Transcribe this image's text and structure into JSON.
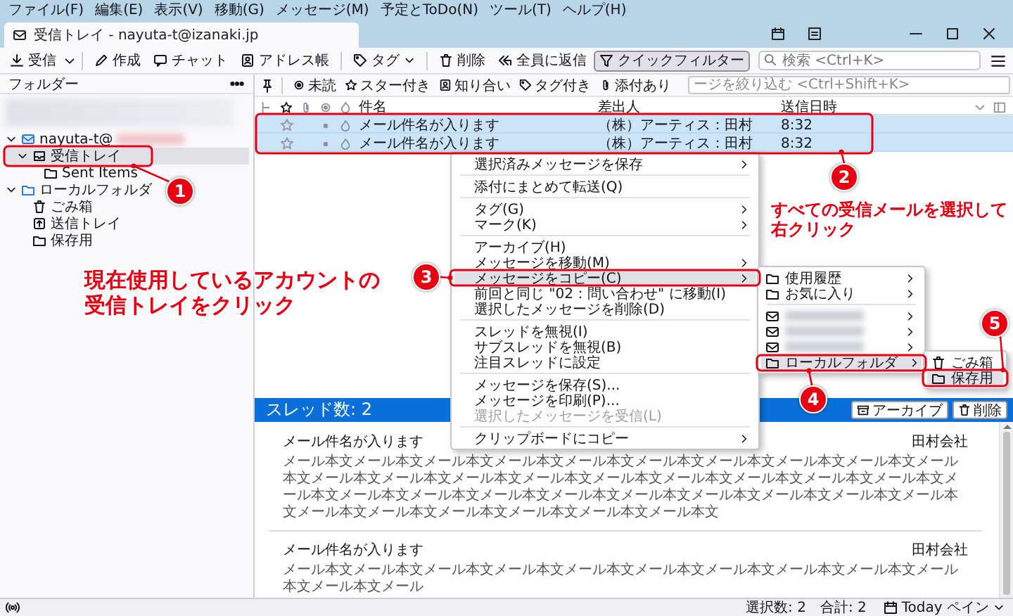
{
  "menubar": [
    "ファイル(F)",
    "編集(E)",
    "表示(V)",
    "移動(G)",
    "メッセージ(M)",
    "予定とToDo(N)",
    "ツール(T)",
    "ヘルプ(H)"
  ],
  "tab": {
    "title": "受信トレイ - nayuta-t@izanaki.jp"
  },
  "toolbar": {
    "buttons": [
      {
        "label": "受信",
        "kind": "get",
        "pressed": false
      },
      {
        "label": "作成",
        "kind": "write",
        "pressed": false
      },
      {
        "label": "チャット",
        "kind": "chat",
        "pressed": false
      },
      {
        "label": "アドレス帳",
        "kind": "address",
        "pressed": false
      },
      {
        "label": "タグ",
        "kind": "tag",
        "pressed": false
      },
      {
        "label": "削除",
        "kind": "delete",
        "pressed": false
      },
      {
        "label": "全員に返信",
        "kind": "replyall",
        "pressed": false
      },
      {
        "label": "クイックフィルター",
        "kind": "filter",
        "pressed": true
      }
    ],
    "search": {
      "placeholder": "検索 <Ctrl+K>"
    }
  },
  "folder_pane": {
    "title": "フォルダー",
    "folders": [
      {
        "label": "nayuta-t@",
        "kind": "account",
        "expanded": true,
        "selected": false,
        "children": [
          {
            "label": "受信トレイ",
            "kind": "inbox",
            "expanded": true,
            "selected": true,
            "children": [
              {
                "label": "Sent Items",
                "kind": "folder",
                "selected": false
              }
            ]
          }
        ]
      },
      {
        "label": "ローカルフォルダ",
        "kind": "local",
        "expanded": true,
        "selected": false,
        "children": [
          {
            "label": "ごみ箱",
            "kind": "trash",
            "selected": false
          },
          {
            "label": "送信トレイ",
            "kind": "outbox",
            "selected": false
          },
          {
            "label": "保存用",
            "kind": "folder",
            "selected": false
          }
        ]
      }
    ]
  },
  "quick_filter": {
    "buttons": [
      {
        "label": "未読",
        "kind": "unread"
      },
      {
        "label": "スター付き",
        "kind": "star"
      },
      {
        "label": "知り合い",
        "kind": "contact"
      },
      {
        "label": "タグ付き",
        "kind": "tag"
      },
      {
        "label": "添付あり",
        "kind": "attach"
      }
    ],
    "filter": {
      "placeholder": "ージを絞り込む <Ctrl+Shift+K>"
    }
  },
  "message_list": {
    "columns": [
      "件名",
      "差出人",
      "送信日時"
    ],
    "rows": [
      {
        "subject": "メール件名が入ります",
        "from": "（株）アーティス：田村",
        "date": "8:32",
        "selected": true,
        "starred": false
      },
      {
        "subject": "メール件名が入ります",
        "from": "（株）アーティス：田村",
        "date": "8:32",
        "selected": true,
        "starred": false
      }
    ]
  },
  "context_menu": {
    "items": [
      {
        "label": "選択済みメッセージを保存",
        "kind": "item",
        "submenu": true,
        "disabled": false,
        "highlighted": false
      },
      {
        "kind": "separator"
      },
      {
        "label": "添付にまとめて転送(Q)",
        "kind": "item",
        "submenu": false,
        "disabled": false,
        "highlighted": false
      },
      {
        "kind": "separator"
      },
      {
        "label": "タグ(G)",
        "kind": "item",
        "submenu": true,
        "disabled": false,
        "highlighted": false
      },
      {
        "label": "マーク(K)",
        "kind": "item",
        "submenu": true,
        "disabled": false,
        "highlighted": false
      },
      {
        "kind": "separator"
      },
      {
        "label": "アーカイブ(H)",
        "kind": "item",
        "submenu": false,
        "disabled": false,
        "highlighted": false
      },
      {
        "label": "メッセージを移動(M)",
        "kind": "item",
        "submenu": true,
        "disabled": false,
        "highlighted": false
      },
      {
        "label": "メッセージをコピー(C)",
        "kind": "item",
        "submenu": true,
        "disabled": false,
        "highlighted": true
      },
      {
        "label": "前回と同じ \"02：問い合わせ\" に移動(I)",
        "kind": "item",
        "submenu": false,
        "disabled": false,
        "highlighted": false
      },
      {
        "label": "選択したメッセージを削除(D)",
        "kind": "item",
        "submenu": false,
        "disabled": false,
        "highlighted": false
      },
      {
        "kind": "separator"
      },
      {
        "label": "スレッドを無視(I)",
        "kind": "item",
        "submenu": false,
        "disabled": false,
        "highlighted": false
      },
      {
        "label": "サブスレッドを無視(B)",
        "kind": "item",
        "submenu": false,
        "disabled": false,
        "highlighted": false
      },
      {
        "label": "注目スレッドに設定",
        "kind": "item",
        "submenu": false,
        "disabled": false,
        "highlighted": false
      },
      {
        "kind": "separator"
      },
      {
        "label": "メッセージを保存(S)...",
        "kind": "item",
        "submenu": false,
        "disabled": false,
        "highlighted": false
      },
      {
        "label": "メッセージを印刷(P)...",
        "kind": "item",
        "submenu": false,
        "disabled": false,
        "highlighted": false
      },
      {
        "label": "選択したメッセージを受信(L)",
        "kind": "item",
        "submenu": false,
        "disabled": true,
        "highlighted": false
      },
      {
        "kind": "separator"
      },
      {
        "label": "クリップボードにコピー",
        "kind": "item",
        "submenu": true,
        "disabled": false,
        "highlighted": false
      }
    ]
  },
  "copy_submenu": {
    "items": [
      {
        "label": "使用履歴",
        "kind": "folder",
        "submenu": true,
        "highlighted": false
      },
      {
        "label": "お気に入り",
        "kind": "folder",
        "submenu": true,
        "highlighted": false
      },
      {
        "kind": "separator"
      },
      {
        "kind": "account",
        "submenu": true,
        "highlighted": false
      },
      {
        "kind": "account",
        "submenu": true,
        "highlighted": false
      },
      {
        "kind": "account",
        "submenu": true,
        "highlighted": false
      },
      {
        "label": "ローカルフォルダ",
        "kind": "folder",
        "submenu": true,
        "highlighted": true
      }
    ]
  },
  "folder_submenu": {
    "items": [
      {
        "label": "ごみ箱",
        "kind": "trash",
        "highlighted": false
      },
      {
        "label": "保存用",
        "kind": "folder",
        "highlighted": true
      }
    ]
  },
  "thread_summary": {
    "title": "スレッド数: 2",
    "buttons": [
      {
        "label": "アーカイブ",
        "kind": "archive"
      },
      {
        "label": "削除",
        "kind": "delete"
      }
    ],
    "messages": [
      {
        "subject": "メール件名が入ります",
        "sender": "田村会社",
        "body": "メール本文メール本文メール本文メール本文メール本文メール本文メール本文メール本文メール本文メール本文メール本文メール本文メール本文メール本文メール本文メール本文メール本文メール本文メール本文メール本文メール本文メール本文メール本文メール本文メール本文メール本文メール本文メール本文メール本文メール本文メール本文メール本文メール本文メール本文メール本文"
      },
      {
        "subject": "メール件名が入ります",
        "sender": "田村会社",
        "body": "メール本文メール本文メール本文メール本文メール本文メール本文メール本文メール本文メール本文メール本文メール本文メール"
      }
    ]
  },
  "status_bar": {
    "selected": "選択数: 2",
    "total": "合計: 2",
    "today_pane": "Today ペイン"
  },
  "annotations": {
    "steps": [
      {
        "number": "1"
      },
      {
        "number": "2"
      },
      {
        "number": "3"
      },
      {
        "number": "4"
      },
      {
        "number": "5"
      }
    ],
    "notes": [
      {
        "lines": [
          "現在使用しているアカウントの",
          "受信トレイをクリック"
        ]
      },
      {
        "lines": [
          "すべての受信メールを選択して",
          "右クリック"
        ]
      }
    ]
  }
}
